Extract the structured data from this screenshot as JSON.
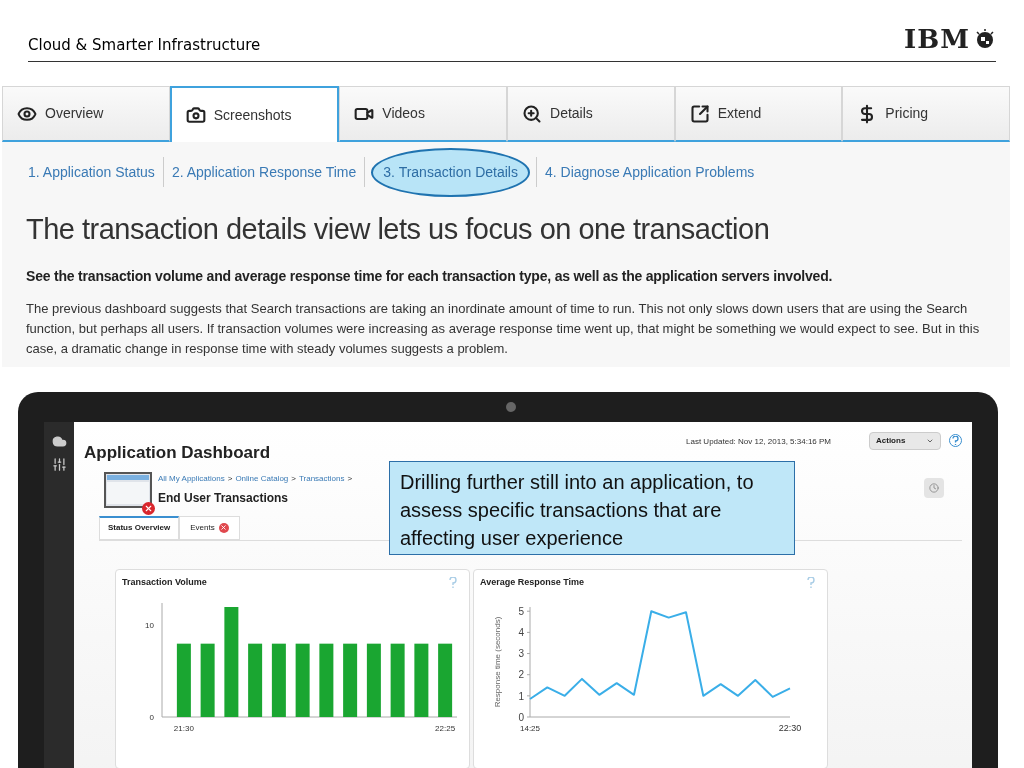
{
  "header": {
    "title": "Cloud & Smarter Infrastructure",
    "logo": "IBM"
  },
  "tabs": [
    {
      "label": "Overview",
      "selected": false
    },
    {
      "label": "Screenshots",
      "selected": true
    },
    {
      "label": "Videos",
      "selected": false
    },
    {
      "label": "Details",
      "selected": false
    },
    {
      "label": "Extend",
      "selected": false
    },
    {
      "label": "Pricing",
      "selected": false
    }
  ],
  "steps": [
    {
      "label": "1. Application Status",
      "selected": false
    },
    {
      "label": "2. Application Response Time",
      "selected": false
    },
    {
      "label": "3. Transaction Details",
      "selected": true
    },
    {
      "label": "4. Diagnose Application Problems",
      "selected": false
    }
  ],
  "heading": "The transaction details view lets us focus on one transaction",
  "subheading": "See the transaction volume and average response time for each transaction type, as well as the application servers involved.",
  "paragraph": "The previous dashboard suggests that Search transactions are taking an inordinate amount of time to run. This not only slows down users that are using the Search function, but perhaps all users. If transaction volumes were increasing as average response time went up, that might be something we would expect to see. But in this case, a dramatic change in response time with steady volumes suggests a problem.",
  "dashboard": {
    "title": "Application Dashboard",
    "last_updated": "Last Updated: Nov 12, 2013, 5:34:16 PM",
    "actions": "Actions",
    "breadcrumbs": [
      "All My Applications",
      ">",
      "Online Catalog",
      ">",
      "Transactions",
      ">"
    ],
    "page_title": "End User Transactions",
    "tabs": [
      {
        "label": "Status Overview",
        "selected": true,
        "alert": false
      },
      {
        "label": "Events",
        "selected": false,
        "alert": true
      }
    ],
    "panels": [
      {
        "title": "Transaction Volume",
        "chart_data": {
          "type": "bar",
          "categories": [
            "21:30",
            null,
            null,
            null,
            null,
            null,
            null,
            null,
            null,
            null,
            null,
            "22:25"
          ],
          "series": [
            {
              "color": "#1aa631",
              "values": [
                8,
                8,
                12,
                8,
                8,
                8,
                8,
                8,
                8,
                8,
                8,
                8
              ]
            }
          ],
          "ylim": [
            0,
            12
          ],
          "yticks": [
            0,
            10
          ]
        }
      },
      {
        "title": "Average Response Time",
        "chart_data": {
          "type": "line",
          "ylabel": "Response time (seconds)",
          "categories": [
            "14:25",
            null,
            null,
            null,
            null,
            null,
            null,
            null,
            null,
            null,
            null,
            null,
            null,
            null,
            null,
            "22:30"
          ],
          "series": [
            {
              "color": "#3aaee8",
              "values": [
                0.85,
                1.4,
                1.0,
                1.8,
                1.05,
                1.6,
                1.05,
                5.0,
                4.7,
                4.95,
                1.0,
                1.55,
                1.0,
                1.75,
                0.95,
                1.35
              ]
            }
          ],
          "ylim": [
            0,
            5.2
          ],
          "yticks": [
            0,
            1,
            2,
            3,
            4,
            5
          ]
        }
      }
    ]
  },
  "callout": "Drilling further still into an application, to assess specific transactions that are affecting user experience"
}
